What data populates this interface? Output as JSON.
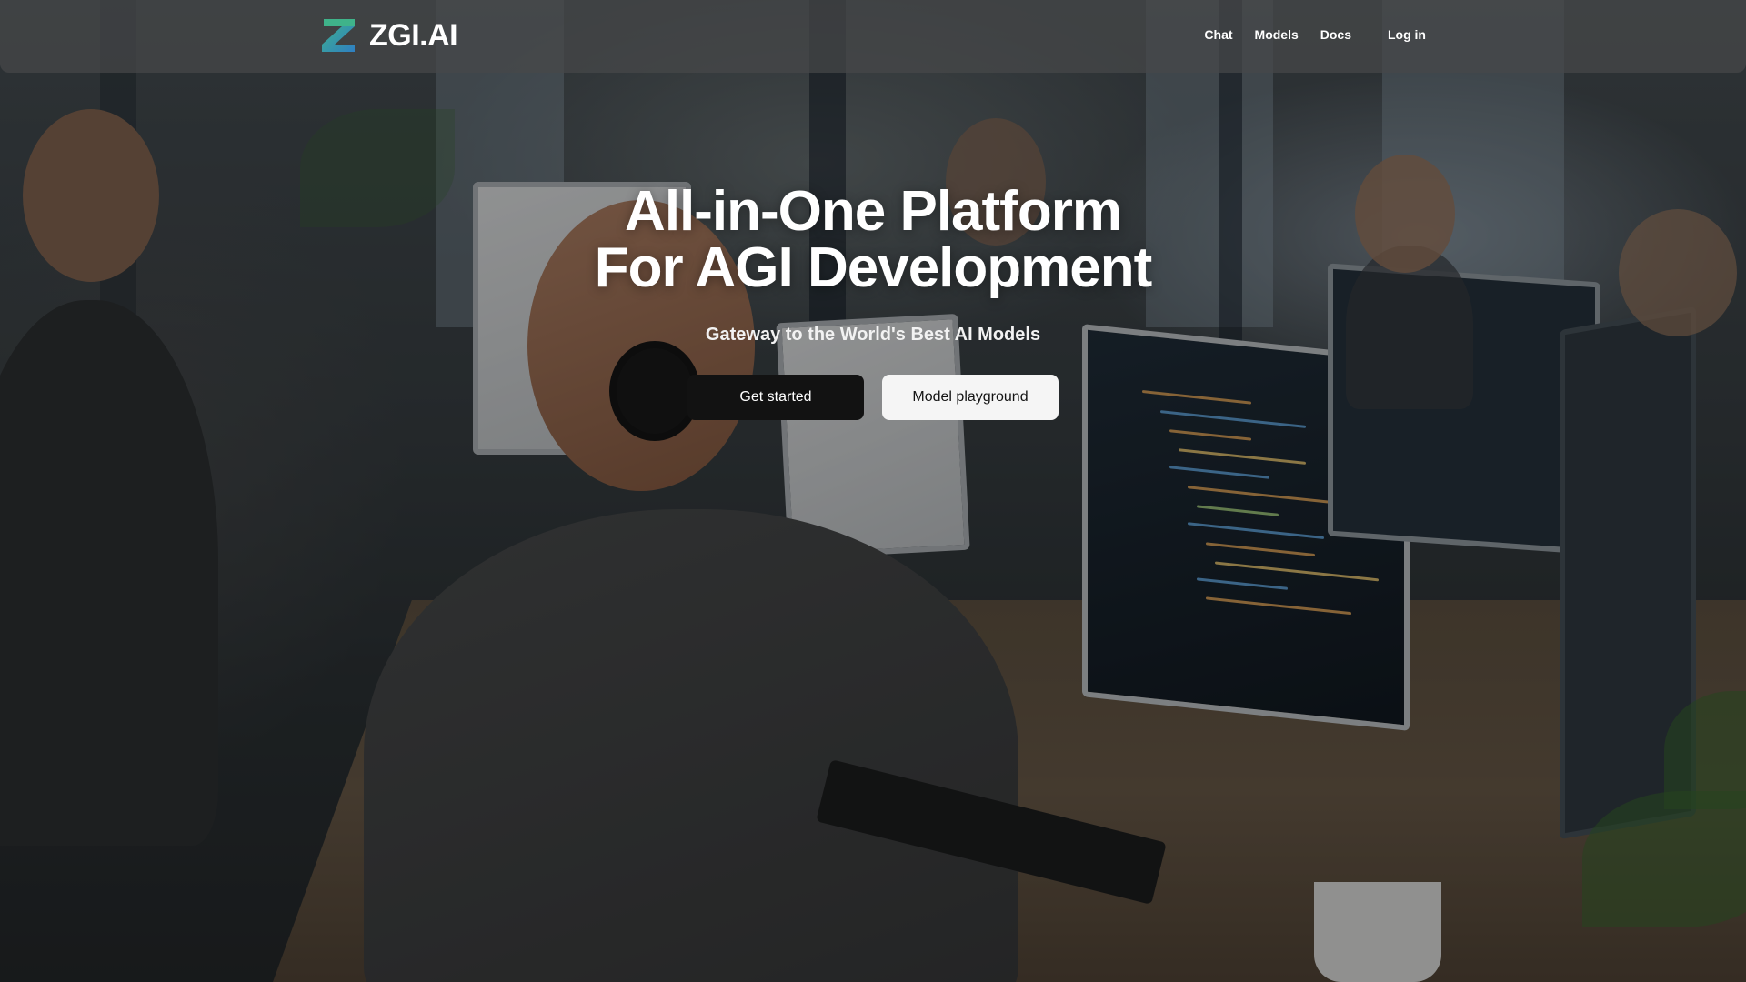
{
  "brand": {
    "name": "ZGI.AI",
    "logo_icon": "zgi-logo-icon",
    "logo_colors": [
      "#3fb38a",
      "#2f7fc2"
    ]
  },
  "nav": {
    "items": [
      {
        "label": "Chat"
      },
      {
        "label": "Models"
      },
      {
        "label": "Docs"
      }
    ],
    "login_label": "Log in"
  },
  "hero": {
    "title_line1": "All-in-One Platform",
    "title_line2": "For AGI Development",
    "subtitle": "Gateway to the World's Best AI Models",
    "primary_cta": "Get started",
    "secondary_cta": "Model playground"
  },
  "colors": {
    "header_bg": "#46484a",
    "primary_button": "#121212",
    "secondary_button": "#f5f5f5",
    "text": "#ffffff"
  }
}
